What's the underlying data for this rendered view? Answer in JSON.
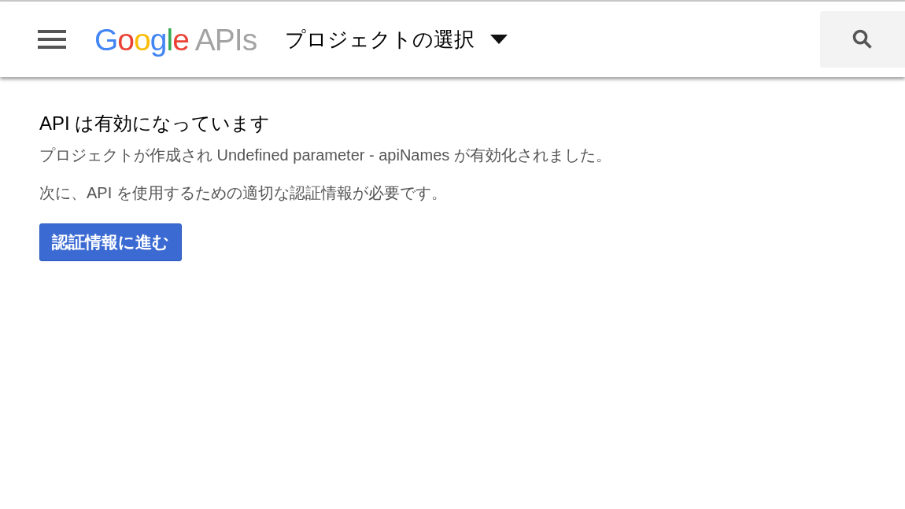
{
  "header": {
    "logo_primary": "Google",
    "logo_secondary": "APIs",
    "project_selector": "プロジェクトの選択"
  },
  "content": {
    "title": "API は有効になっています",
    "paragraphs": [
      "プロジェクトが作成され Undefined parameter - apiNames が有効化されました。",
      "次に、API を使用するための適切な認証情報が必要です。"
    ],
    "button": "認証情報に進む"
  }
}
